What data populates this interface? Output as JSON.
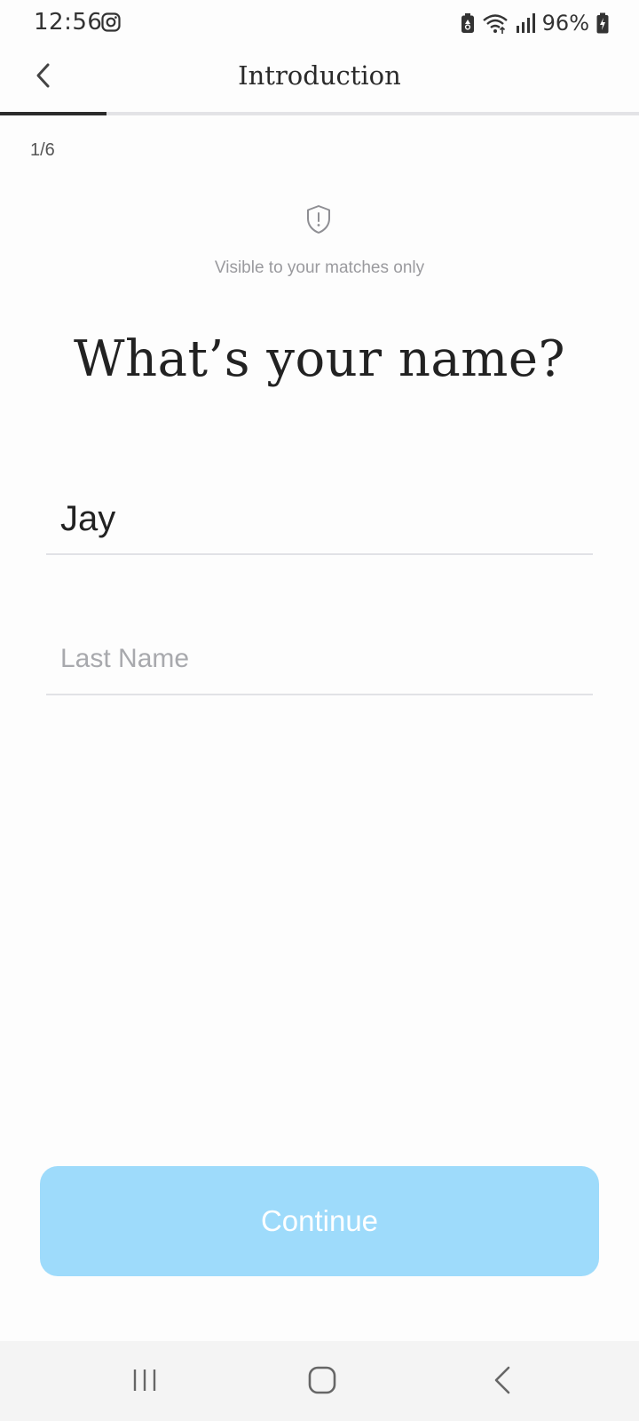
{
  "status_bar": {
    "time": "12:56",
    "battery_percent": "96%",
    "icons": [
      "instagram-icon",
      "battery-saver-icon",
      "wifi-icon",
      "signal-icon",
      "battery-charging-icon"
    ]
  },
  "header": {
    "title": "Introduction",
    "back_icon": "chevron-left-icon"
  },
  "progress": {
    "fraction": 0.1667,
    "step_label": "1/6"
  },
  "privacy": {
    "icon": "shield-alert-icon",
    "note": "Visible to your matches only"
  },
  "question": "What’s your name?",
  "form": {
    "first_name_value": "Jay",
    "last_name_placeholder": "Last Name",
    "last_name_value": ""
  },
  "continue_label": "Continue",
  "colors": {
    "continue_button": "#9edbfb",
    "progress_fill": "#2b2b2b",
    "progress_track": "#e3e3e6"
  },
  "nav_bar": {
    "icons": [
      "recents-icon",
      "home-icon",
      "back-icon"
    ]
  }
}
